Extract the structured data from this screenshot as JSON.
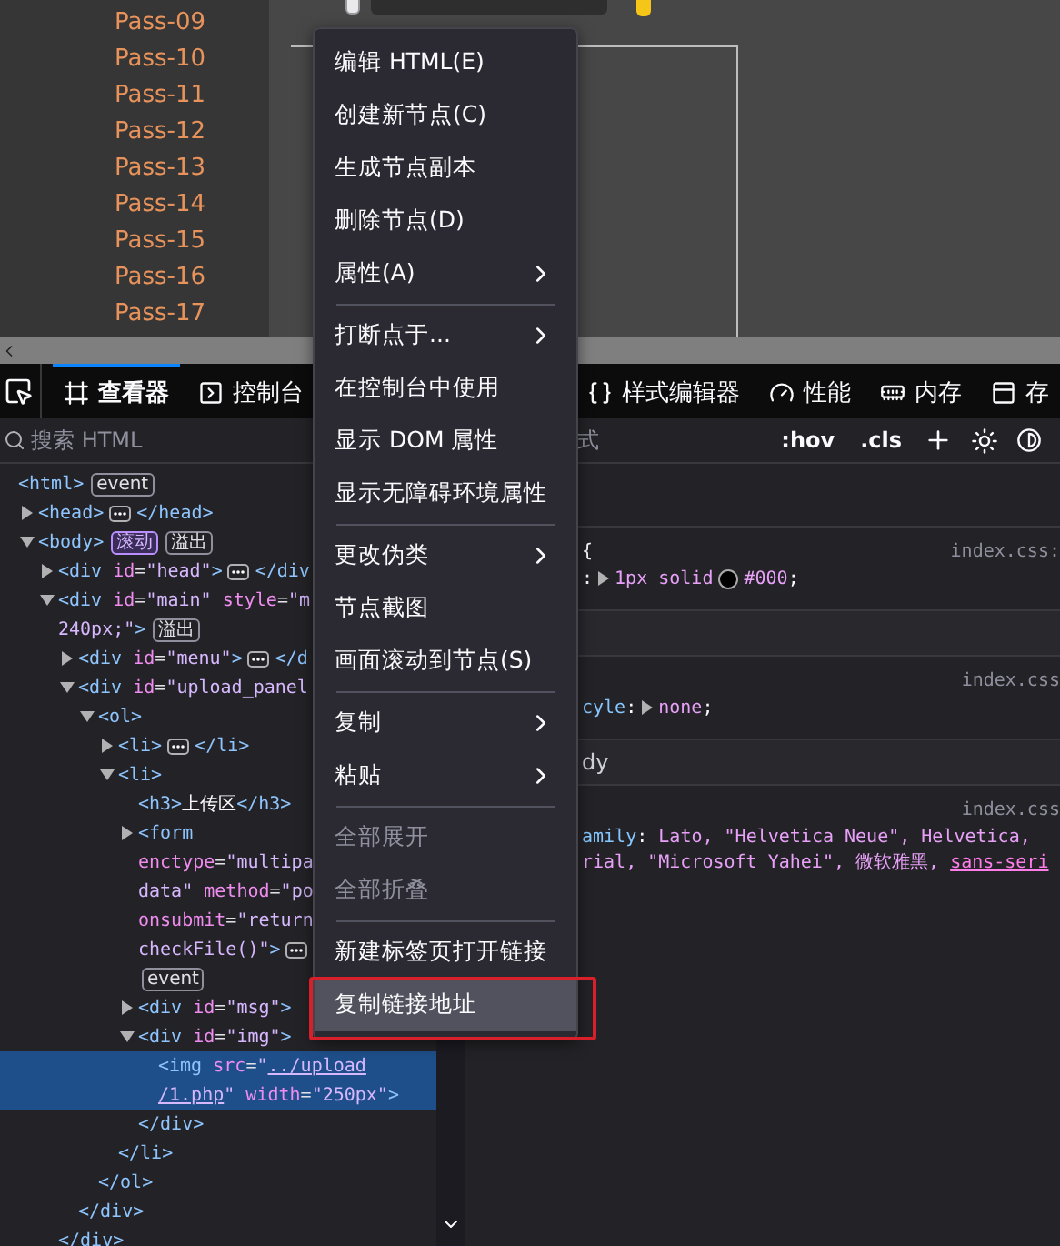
{
  "page": {
    "sidebar": [
      {
        "label": "Pass-09"
      },
      {
        "label": "Pass-10"
      },
      {
        "label": "Pass-11"
      },
      {
        "label": "Pass-12"
      },
      {
        "label": "Pass-13"
      },
      {
        "label": "Pass-14"
      },
      {
        "label": "Pass-15"
      },
      {
        "label": "Pass-16"
      },
      {
        "label": "Pass-17"
      }
    ]
  },
  "devtools": {
    "tabs": [
      {
        "label": "查看器",
        "selected": true
      },
      {
        "label": "控制台",
        "selected": false
      },
      {
        "label": "样式编辑器",
        "selected": false
      },
      {
        "label": "性能",
        "selected": false
      },
      {
        "label": "内存",
        "selected": false
      },
      {
        "label": "存",
        "selected": false
      }
    ],
    "search": {
      "placeholder": "搜索 HTML"
    },
    "rules_filter": {
      "placeholder": "式"
    },
    "rules_toggles": [
      ":hov",
      ".cls"
    ],
    "tree": [
      {
        "lines": [
          [
            {
              "kind": "tag",
              "text": "<html>"
            },
            {
              "kind": "badge",
              "text": "event"
            }
          ]
        ],
        "selected": false,
        "children": [
          {
            "expanded": false,
            "selected": false,
            "lines": [
              [
                {
                  "kind": "tag",
                  "text": "<head>"
                },
                {
                  "kind": "more"
                },
                {
                  "kind": "tag",
                  "text": "</head>"
                }
              ]
            ]
          },
          {
            "expanded": true,
            "selected": false,
            "lines": [
              [
                {
                  "kind": "tag",
                  "text": "<body>"
                },
                {
                  "kind": "badge-on",
                  "text": "滚动"
                },
                {
                  "kind": "badge",
                  "text": "溢出"
                }
              ]
            ],
            "children": [
              {
                "expanded": false,
                "selected": false,
                "lines": [
                  [
                    {
                      "kind": "tag",
                      "text": "<div"
                    },
                    {
                      "kind": "attr",
                      "text": " id"
                    },
                    {
                      "kind": "eq",
                      "text": "="
                    },
                    {
                      "kind": "val",
                      "text": "\"head\""
                    },
                    {
                      "kind": "tag",
                      "text": ">"
                    },
                    {
                      "kind": "more"
                    },
                    {
                      "kind": "tag",
                      "text": "</div"
                    }
                  ]
                ]
              },
              {
                "expanded": true,
                "selected": false,
                "lines": [
                  [
                    {
                      "kind": "tag",
                      "text": "<div"
                    },
                    {
                      "kind": "attr",
                      "text": " id"
                    },
                    {
                      "kind": "eq",
                      "text": "="
                    },
                    {
                      "kind": "val",
                      "text": "\"main\""
                    },
                    {
                      "kind": "attr",
                      "text": " style"
                    },
                    {
                      "kind": "eq",
                      "text": "="
                    },
                    {
                      "kind": "val",
                      "text": "\"m"
                    }
                  ],
                  [
                    {
                      "kind": "val",
                      "text": "240px;\""
                    },
                    {
                      "kind": "tag",
                      "text": ">"
                    },
                    {
                      "kind": "badge",
                      "text": "溢出"
                    }
                  ]
                ],
                "children": [
                  {
                    "expanded": false,
                    "selected": false,
                    "lines": [
                      [
                        {
                          "kind": "tag",
                          "text": "<div"
                        },
                        {
                          "kind": "attr",
                          "text": " id"
                        },
                        {
                          "kind": "eq",
                          "text": "="
                        },
                        {
                          "kind": "val",
                          "text": "\"menu\""
                        },
                        {
                          "kind": "tag",
                          "text": ">"
                        },
                        {
                          "kind": "more"
                        },
                        {
                          "kind": "tag",
                          "text": "</d"
                        }
                      ]
                    ]
                  },
                  {
                    "expanded": true,
                    "selected": false,
                    "lines": [
                      [
                        {
                          "kind": "tag",
                          "text": "<div"
                        },
                        {
                          "kind": "attr",
                          "text": " id"
                        },
                        {
                          "kind": "eq",
                          "text": "="
                        },
                        {
                          "kind": "val",
                          "text": "\"upload_panel"
                        }
                      ]
                    ],
                    "children": [
                      {
                        "expanded": true,
                        "selected": false,
                        "lines": [
                          [
                            {
                              "kind": "tag",
                              "text": "<ol>"
                            }
                          ]
                        ],
                        "children": [
                          {
                            "expanded": false,
                            "selected": false,
                            "lines": [
                              [
                                {
                                  "kind": "tag",
                                  "text": "<li>"
                                },
                                {
                                  "kind": "more"
                                },
                                {
                                  "kind": "tag",
                                  "text": "</li>"
                                }
                              ]
                            ]
                          },
                          {
                            "expanded": true,
                            "selected": false,
                            "lines": [
                              [
                                {
                                  "kind": "tag",
                                  "text": "<li>"
                                }
                              ]
                            ],
                            "children": [
                              {
                                "selected": false,
                                "lines": [
                                  [
                                    {
                                      "kind": "tag",
                                      "text": "<h3>"
                                    },
                                    {
                                      "kind": "text",
                                      "text": "上传区"
                                    },
                                    {
                                      "kind": "tag",
                                      "text": "</h3>"
                                    }
                                  ]
                                ]
                              },
                              {
                                "expanded": false,
                                "selected": false,
                                "lines": [
                                  [
                                    {
                                      "kind": "tag",
                                      "text": "<form"
                                    }
                                  ],
                                  [
                                    {
                                      "kind": "attr",
                                      "text": "enctype"
                                    },
                                    {
                                      "kind": "eq",
                                      "text": "="
                                    },
                                    {
                                      "kind": "val",
                                      "text": "\"multipa"
                                    }
                                  ],
                                  [
                                    {
                                      "kind": "val",
                                      "text": "data\""
                                    },
                                    {
                                      "kind": "attr",
                                      "text": " method"
                                    },
                                    {
                                      "kind": "eq",
                                      "text": "="
                                    },
                                    {
                                      "kind": "val",
                                      "text": "\"po"
                                    }
                                  ],
                                  [
                                    {
                                      "kind": "attr",
                                      "text": "onsubmit"
                                    },
                                    {
                                      "kind": "eq",
                                      "text": "="
                                    },
                                    {
                                      "kind": "val",
                                      "text": "\"return"
                                    }
                                  ],
                                  [
                                    {
                                      "kind": "val",
                                      "text": "checkFile()\""
                                    },
                                    {
                                      "kind": "tag",
                                      "text": ">"
                                    },
                                    {
                                      "kind": "more"
                                    }
                                  ],
                                  [
                                    {
                                      "kind": "badge",
                                      "text": "event"
                                    }
                                  ]
                                ]
                              },
                              {
                                "expanded": false,
                                "selected": false,
                                "lines": [
                                  [
                                    {
                                      "kind": "tag",
                                      "text": "<div"
                                    },
                                    {
                                      "kind": "attr",
                                      "text": " id"
                                    },
                                    {
                                      "kind": "eq",
                                      "text": "="
                                    },
                                    {
                                      "kind": "val",
                                      "text": "\"msg\""
                                    },
                                    {
                                      "kind": "tag",
                                      "text": ">"
                                    }
                                  ]
                                ]
                              },
                              {
                                "expanded": true,
                                "selected": false,
                                "lines": [
                                  [
                                    {
                                      "kind": "tag",
                                      "text": "<div"
                                    },
                                    {
                                      "kind": "attr",
                                      "text": " id"
                                    },
                                    {
                                      "kind": "eq",
                                      "text": "="
                                    },
                                    {
                                      "kind": "val",
                                      "text": "\"img\""
                                    },
                                    {
                                      "kind": "tag",
                                      "text": ">"
                                    }
                                  ]
                                ],
                                "children": [
                                  {
                                    "selected": true,
                                    "lines": [
                                      [
                                        {
                                          "kind": "tag",
                                          "text": "<img"
                                        },
                                        {
                                          "kind": "attr",
                                          "text": " src"
                                        },
                                        {
                                          "kind": "eq",
                                          "text": "="
                                        },
                                        {
                                          "kind": "val",
                                          "text": "\""
                                        },
                                        {
                                          "kind": "link",
                                          "text": "../upload"
                                        }
                                      ],
                                      [
                                        {
                                          "kind": "link",
                                          "text": "/1.php"
                                        },
                                        {
                                          "kind": "val",
                                          "text": "\""
                                        },
                                        {
                                          "kind": "attr",
                                          "text": " width"
                                        },
                                        {
                                          "kind": "eq",
                                          "text": "="
                                        },
                                        {
                                          "kind": "val",
                                          "text": "\"250px\""
                                        },
                                        {
                                          "kind": "tag",
                                          "text": ">"
                                        }
                                      ]
                                    ]
                                  }
                                ],
                                "closing": [
                                  {
                                    "kind": "tag",
                                    "text": "</div>"
                                  }
                                ]
                              }
                            ],
                            "closing": [
                              {
                                "kind": "tag",
                                "text": "</li>"
                              }
                            ]
                          }
                        ],
                        "closing": [
                          {
                            "kind": "tag",
                            "text": "</ol>"
                          }
                        ]
                      }
                    ],
                    "closing": [
                      {
                        "kind": "tag",
                        "text": "</div>"
                      }
                    ]
                  }
                ],
                "closing": [
                  {
                    "kind": "tag",
                    "text": "</div>"
                  }
                ]
              }
            ]
          }
        ]
      }
    ],
    "rules": [
      {
        "kind": "rule",
        "source": "index.css:",
        "selector": "{",
        "lines": [
          [
            {
              "kind": "punct",
              "text": ":"
            },
            {
              "kind": "twisty"
            },
            {
              "kind": "value",
              "text": "1px solid"
            },
            {
              "kind": "swatch",
              "color": "#000000"
            },
            {
              "kind": "value",
              "text": "#000"
            },
            {
              "kind": "punct",
              "text": ";"
            }
          ]
        ]
      },
      {
        "kind": "inherited"
      },
      {
        "kind": "rule",
        "source": "index.css",
        "lines": [
          [
            {
              "kind": "prop",
              "text": "cyle"
            },
            {
              "kind": "punct",
              "text": ":"
            },
            {
              "kind": "twisty"
            },
            {
              "kind": "value",
              "text": "none"
            },
            {
              "kind": "punct",
              "text": ";"
            }
          ]
        ]
      },
      {
        "kind": "inherited",
        "label": "dy"
      },
      {
        "kind": "rule",
        "source": "index.css",
        "lines": [
          [
            {
              "kind": "prop",
              "text": "amily"
            },
            {
              "kind": "punct",
              "text": ": "
            },
            {
              "kind": "value",
              "text": "Lato, \"Helvetica Neue\", Helvetica,"
            }
          ],
          [
            {
              "kind": "value",
              "text": "rial, \"Microsoft Yahei\", 微软雅黑, "
            },
            {
              "kind": "link",
              "text": "sans-seri"
            }
          ]
        ]
      }
    ]
  },
  "context_menu": {
    "items": [
      {
        "kind": "item",
        "label": "编辑 HTML(E)",
        "submenu": false,
        "disabled": false,
        "highlighted": false
      },
      {
        "kind": "item",
        "label": "创建新节点(C)",
        "submenu": false,
        "disabled": false,
        "highlighted": false
      },
      {
        "kind": "item",
        "label": "生成节点副本",
        "submenu": false,
        "disabled": false,
        "highlighted": false
      },
      {
        "kind": "item",
        "label": "删除节点(D)",
        "submenu": false,
        "disabled": false,
        "highlighted": false
      },
      {
        "kind": "item",
        "label": "属性(A)",
        "submenu": true,
        "disabled": false,
        "highlighted": false
      },
      {
        "kind": "separator"
      },
      {
        "kind": "item",
        "label": "打断点于...",
        "submenu": true,
        "disabled": false,
        "highlighted": false
      },
      {
        "kind": "item",
        "label": "在控制台中使用",
        "submenu": false,
        "disabled": false,
        "highlighted": false
      },
      {
        "kind": "item",
        "label": "显示 DOM 属性",
        "submenu": false,
        "disabled": false,
        "highlighted": false
      },
      {
        "kind": "item",
        "label": "显示无障碍环境属性",
        "submenu": false,
        "disabled": false,
        "highlighted": false
      },
      {
        "kind": "separator"
      },
      {
        "kind": "item",
        "label": "更改伪类",
        "submenu": true,
        "disabled": false,
        "highlighted": false
      },
      {
        "kind": "item",
        "label": "节点截图",
        "submenu": false,
        "disabled": false,
        "highlighted": false
      },
      {
        "kind": "item",
        "label": "画面滚动到节点(S)",
        "submenu": false,
        "disabled": false,
        "highlighted": false
      },
      {
        "kind": "separator"
      },
      {
        "kind": "item",
        "label": "复制",
        "submenu": true,
        "disabled": false,
        "highlighted": false
      },
      {
        "kind": "item",
        "label": "粘贴",
        "submenu": true,
        "disabled": false,
        "highlighted": false
      },
      {
        "kind": "separator"
      },
      {
        "kind": "item",
        "label": "全部展开",
        "submenu": false,
        "disabled": true,
        "highlighted": false
      },
      {
        "kind": "item",
        "label": "全部折叠",
        "submenu": false,
        "disabled": true,
        "highlighted": false
      },
      {
        "kind": "separator"
      },
      {
        "kind": "item",
        "label": "新建标签页打开链接",
        "submenu": false,
        "disabled": false,
        "highlighted": false
      },
      {
        "kind": "item",
        "label": "复制链接地址",
        "submenu": false,
        "disabled": false,
        "highlighted": true
      }
    ]
  }
}
